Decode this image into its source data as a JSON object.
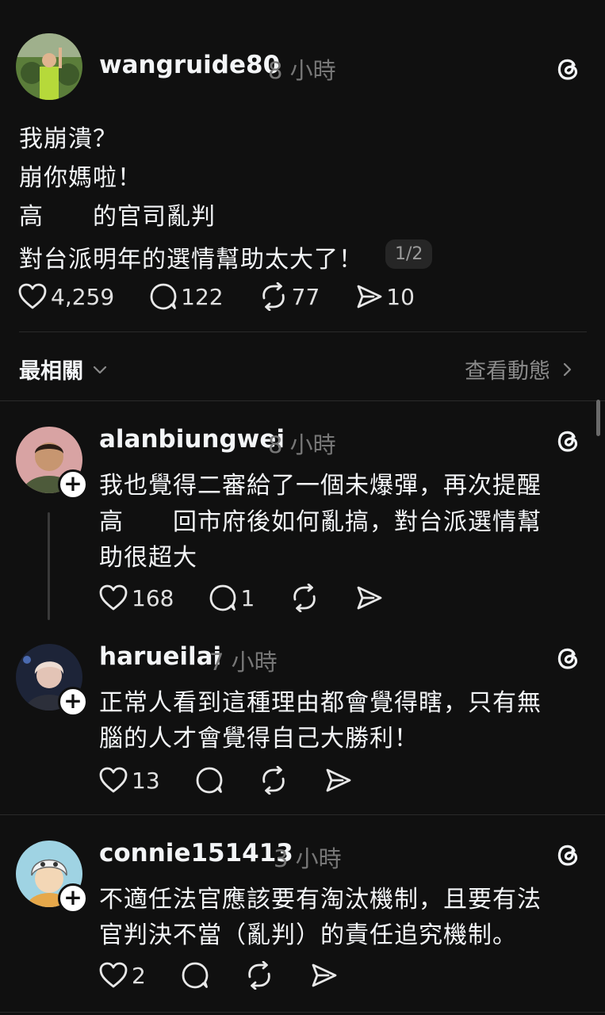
{
  "post": {
    "username": "wangruide80",
    "time": "8 小時",
    "lines": [
      "我崩潰？",
      "崩你媽啦！",
      "高　　的官司亂判",
      "對台派明年的選情幫助太大了！"
    ],
    "page_indicator": "1/2",
    "likes": "4,259",
    "comments": "122",
    "reposts": "77",
    "shares": "10"
  },
  "sort": {
    "label": "最相關",
    "activity_link": "查看動態"
  },
  "replies": [
    {
      "username": "alanbiungwei",
      "time": "8 小時",
      "lines": [
        "我也覺得二審給了一個未爆彈，再次提醒",
        "高　　回市府後如何亂搞，對台派選情幫",
        "助很超大"
      ],
      "likes": "168",
      "comments": "1"
    },
    {
      "username": "harueilai",
      "time": "7 小時",
      "lines": [
        "正常人看到這種理由都會覺得瞎，只有無",
        "腦的人才會覺得自己大勝利！"
      ],
      "likes": "13"
    },
    {
      "username": "connie151413",
      "time": "3 小時",
      "lines": [
        "不適任法官應該要有淘汰機制，且要有法",
        "官判決不當（亂判）的責任追究機制。"
      ],
      "likes": "2"
    }
  ]
}
